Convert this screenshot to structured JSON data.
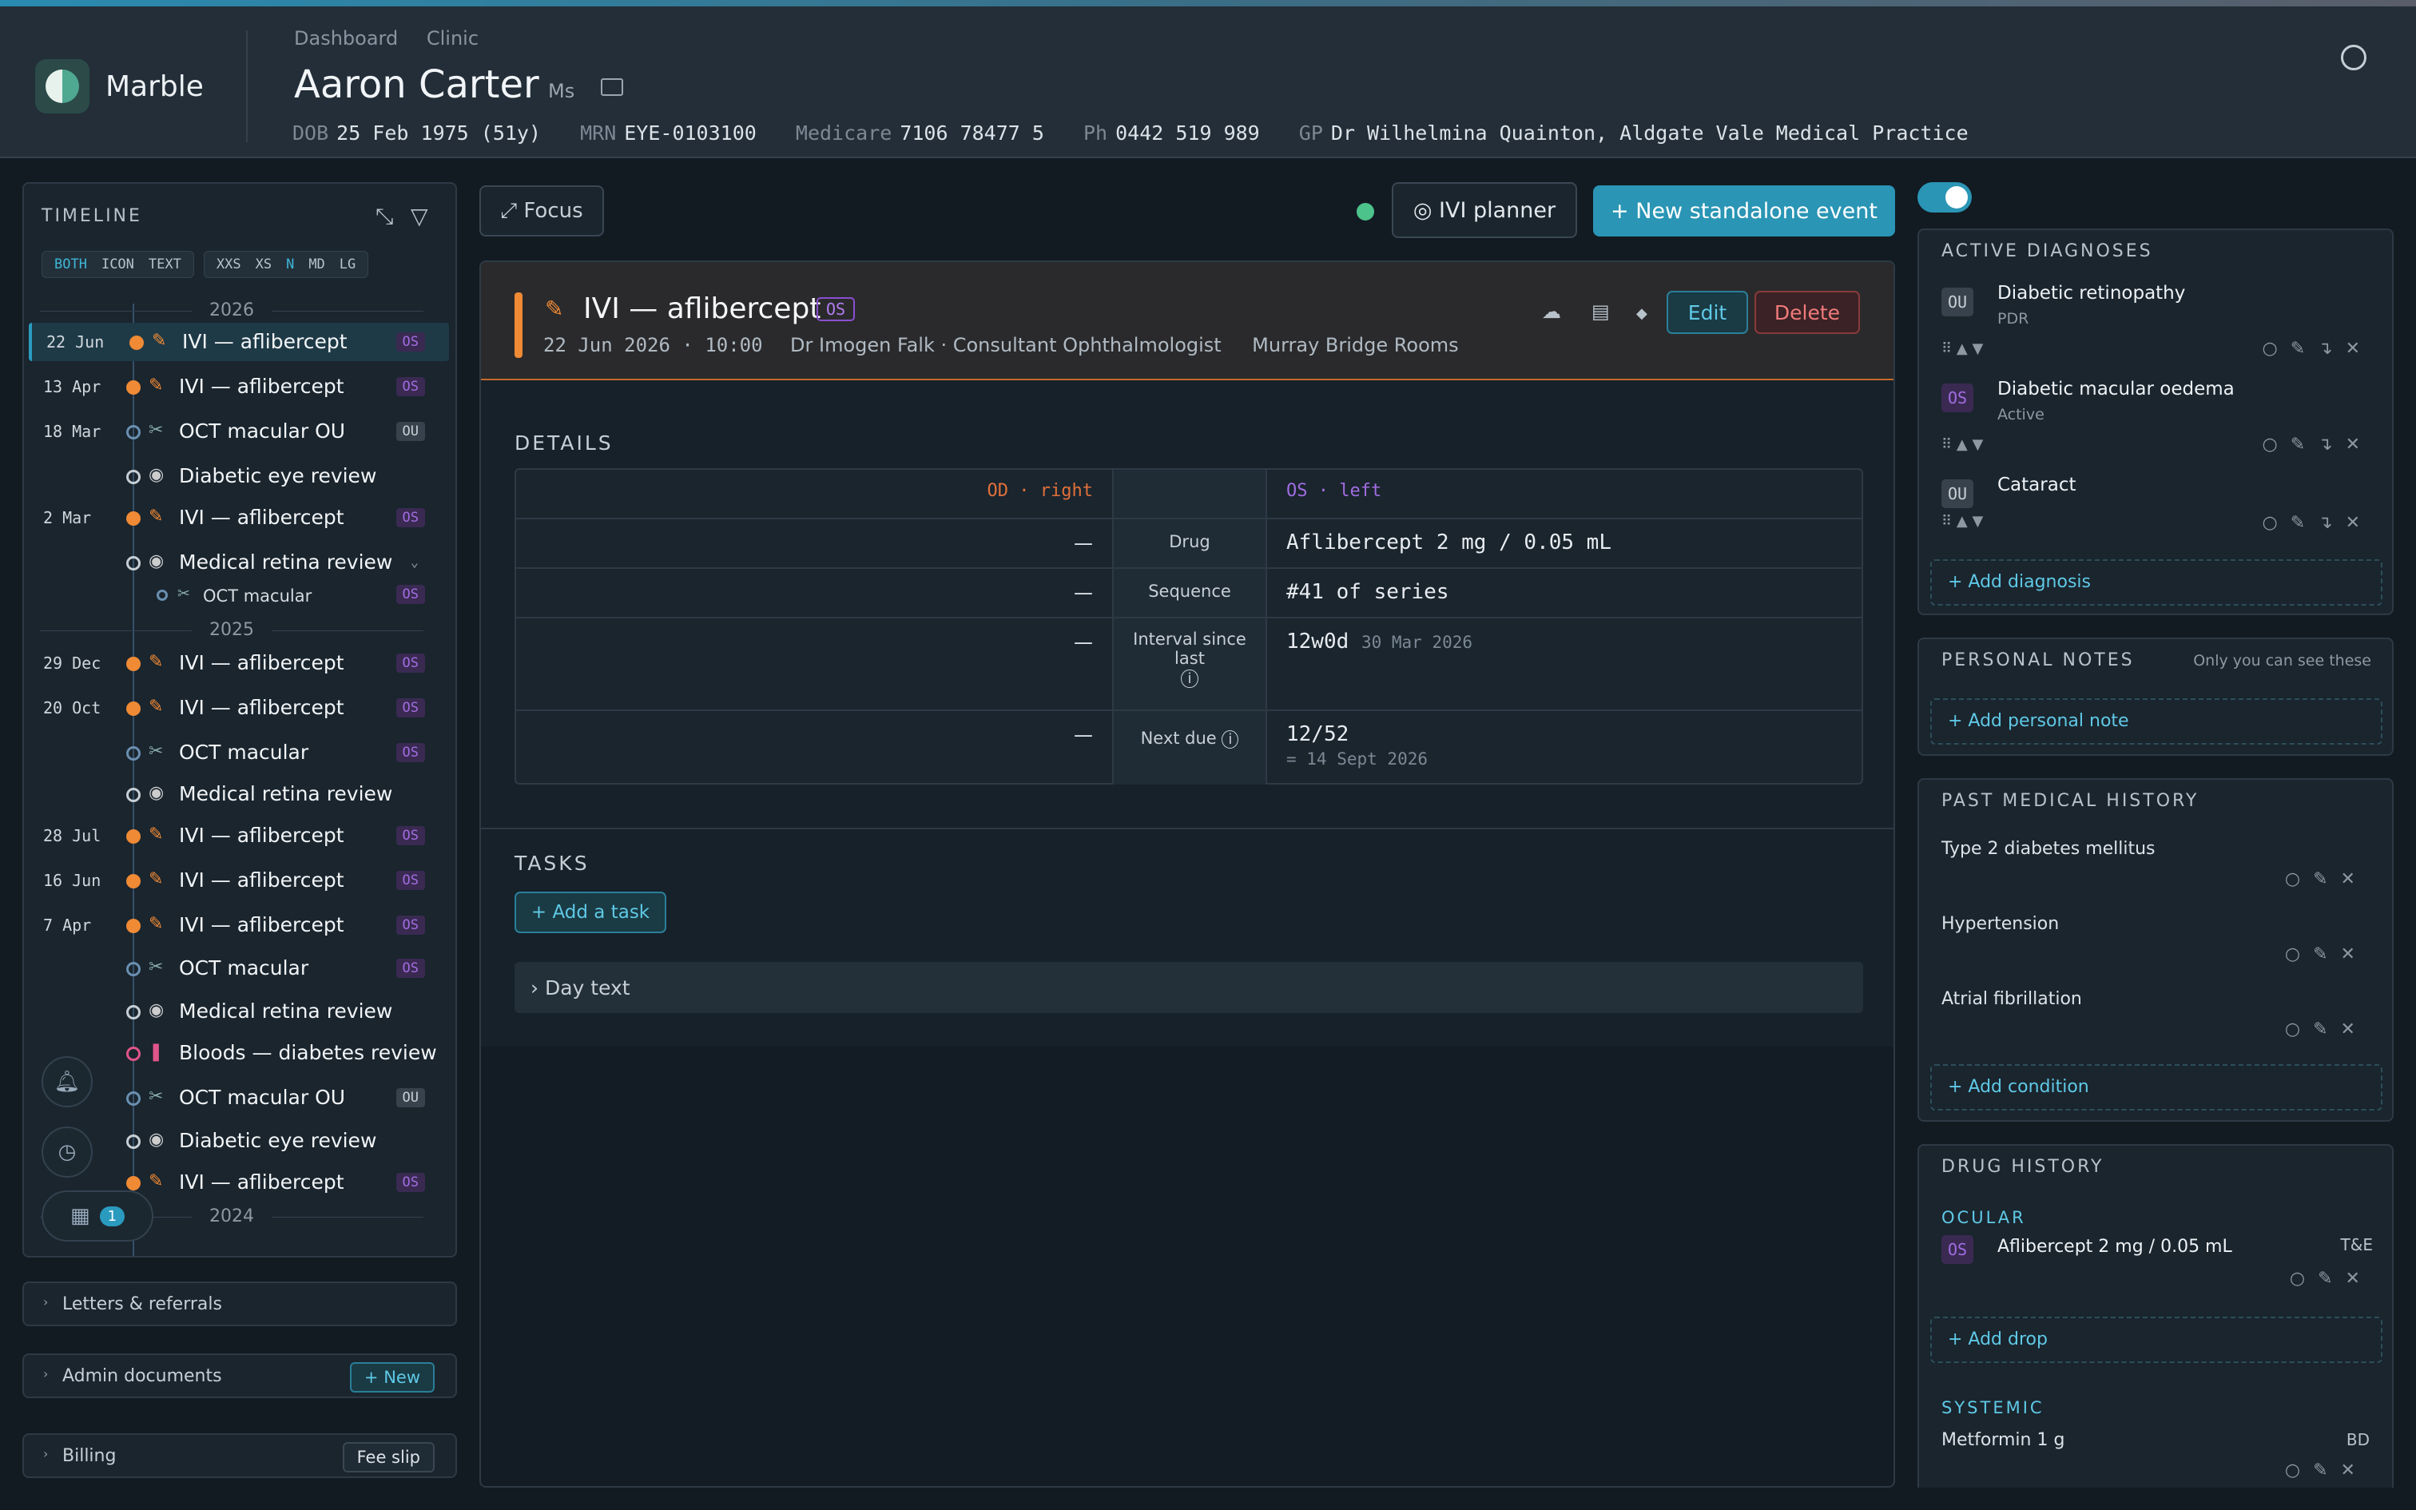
{
  "app": {
    "name": "Marble"
  },
  "breadcrumbs": [
    "Dashboard",
    "Clinic"
  ],
  "patient": {
    "name": "Aaron Carter",
    "title": "Ms",
    "dob_label": "DOB",
    "dob": "25 Feb 1975 (51y)",
    "mrn_label": "MRN",
    "mrn": "EYE-0103100",
    "medicare_label": "Medicare",
    "medicare": "7106 78477 5",
    "ph_label": "Ph",
    "ph": "0442 519 989",
    "gp_label": "GP",
    "gp": "Dr Wilhelmina Quainton, Aldgate Vale Medical Practice"
  },
  "timeline": {
    "title": "TIMELINE",
    "view_modes": [
      "BOTH",
      "ICON",
      "TEXT"
    ],
    "sizes": [
      "XXS",
      "XS",
      "N",
      "MD",
      "LG"
    ],
    "years": [
      "2026",
      "2025",
      "2024"
    ],
    "events": [
      {
        "date": "22 Jun",
        "label": "IVI — aflibercept",
        "eye": "OS"
      },
      {
        "date": "13 Apr",
        "label": "IVI — aflibercept",
        "eye": "OS"
      },
      {
        "date": "18 Mar",
        "label": "OCT macular OU",
        "eye": "OU"
      },
      {
        "date": "",
        "label": "Diabetic eye review",
        "eye": ""
      },
      {
        "date": "2 Mar",
        "label": "IVI — aflibercept",
        "eye": "OS"
      },
      {
        "date": "",
        "label": "Medical retina review",
        "eye": ""
      },
      {
        "date": "",
        "label": "OCT macular",
        "eye": "OS"
      },
      {
        "date": "29 Dec",
        "label": "IVI — aflibercept",
        "eye": "OS"
      },
      {
        "date": "20 Oct",
        "label": "IVI — aflibercept",
        "eye": "OS"
      },
      {
        "date": "",
        "label": "OCT macular",
        "eye": "OS"
      },
      {
        "date": "",
        "label": "Medical retina review",
        "eye": ""
      },
      {
        "date": "28 Jul",
        "label": "IVI — aflibercept",
        "eye": "OS"
      },
      {
        "date": "16 Jun",
        "label": "IVI — aflibercept",
        "eye": "OS"
      },
      {
        "date": "7 Apr",
        "label": "IVI — aflibercept",
        "eye": "OS"
      },
      {
        "date": "",
        "label": "OCT macular",
        "eye": "OS"
      },
      {
        "date": "",
        "label": "Medical retina review",
        "eye": ""
      },
      {
        "date": "",
        "label": "Bloods — diabetes review",
        "eye": ""
      },
      {
        "date": "",
        "label": "OCT macular OU",
        "eye": "OU"
      },
      {
        "date": "",
        "label": "Diabetic eye review",
        "eye": ""
      },
      {
        "date": "",
        "label": "IVI — aflibercept",
        "eye": "OS"
      }
    ],
    "notification_count": "1"
  },
  "sections": {
    "letters": "Letters & referrals",
    "admin": "Admin documents",
    "admin_btn": "+ New",
    "billing": "Billing",
    "billing_btn": "Fee slip"
  },
  "toolbar": {
    "focus": "⤢ Focus",
    "ivi_planner": "◎ IVI planner",
    "new_event": "+ New standalone event"
  },
  "event": {
    "title": "IVI — aflibercept",
    "eye": "OS",
    "date": "22 Jun 2026",
    "time": "10:00",
    "clinician": "Dr Imogen Falk · Consultant Ophthalmologist",
    "location": "Murray Bridge Rooms",
    "edit": "Edit",
    "delete": "Delete"
  },
  "details": {
    "title": "DETAILS",
    "od_header": "OD · right",
    "os_header": "OS · left",
    "rows": [
      {
        "label": "Drug",
        "od": "—",
        "os": "Aflibercept 2 mg / 0.05 mL",
        "os_sub": ""
      },
      {
        "label": "Sequence",
        "od": "—",
        "os": "#41 of series",
        "os_sub": ""
      },
      {
        "label": "Interval since last",
        "od": "—",
        "os": "12w0d",
        "os_sub": "30 Mar 2026"
      },
      {
        "label": "Next due",
        "od": "—",
        "os": "12/52",
        "os_sub": "= 14 Sept 2026"
      }
    ]
  },
  "tasks": {
    "title": "TASKS",
    "add": "+ Add a task",
    "day_text": "› Day text"
  },
  "diagnoses": {
    "title": "ACTIVE DIAGNOSES",
    "items": [
      {
        "eye": "OU",
        "name": "Diabetic retinopathy",
        "status": "PDR"
      },
      {
        "eye": "OS",
        "name": "Diabetic macular oedema",
        "status": "Active"
      },
      {
        "eye": "OU",
        "name": "Cataract",
        "status": ""
      }
    ],
    "add": "+ Add diagnosis"
  },
  "notes": {
    "title": "PERSONAL NOTES",
    "hint": "Only you can see these",
    "add": "+ Add personal note"
  },
  "pmh": {
    "title": "PAST MEDICAL HISTORY",
    "items": [
      "Type 2 diabetes mellitus",
      "Hypertension",
      "Atrial fibrillation"
    ],
    "add": "+ Add condition"
  },
  "drugs": {
    "title": "DRUG HISTORY",
    "ocular_label": "OCULAR",
    "ocular": {
      "eye": "OS",
      "name": "Aflibercept 2 mg / 0.05 mL",
      "freq": "T&E"
    },
    "add": "+ Add drop",
    "systemic_label": "SYSTEMIC",
    "systemic": {
      "name": "Metformin 1 g",
      "freq": "BD"
    }
  },
  "colors": {
    "accent": "#2a95b5",
    "injection": "#f08a35",
    "os": "#a16ce0",
    "od": "#e0703a"
  }
}
